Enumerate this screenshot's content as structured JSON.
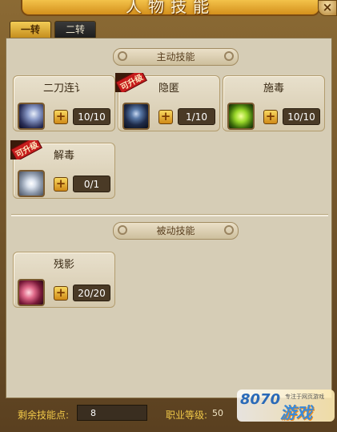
{
  "window": {
    "title": "人物技能",
    "close_label": "×"
  },
  "tabs": [
    {
      "label": "一转",
      "active": true
    },
    {
      "label": "二转",
      "active": false
    }
  ],
  "sections": {
    "active": {
      "title": "主动技能"
    },
    "passive": {
      "title": "被动技能"
    }
  },
  "skills": {
    "s1": {
      "name": "二刀连讠",
      "level": "10/10",
      "upgradable": false,
      "icon": "sword-slash-icon"
    },
    "s2": {
      "name": "隐匿",
      "level": "1/10",
      "upgradable": true,
      "badge": "可升级",
      "icon": "stealth-icon"
    },
    "s3": {
      "name": "施毒",
      "level": "10/10",
      "upgradable": false,
      "icon": "poison-icon"
    },
    "s4": {
      "name": "解毒",
      "level": "0/1",
      "upgradable": true,
      "badge": "可升级",
      "icon": "detox-icon"
    },
    "p1": {
      "name": "残影",
      "level": "20/20",
      "upgradable": false,
      "icon": "afterimage-icon"
    }
  },
  "plus_label": "+",
  "footer": {
    "points_label": "剩余技能点:",
    "points_value": "8",
    "level_label": "职业等级:",
    "level_value": "50"
  },
  "logo": {
    "number": "8070",
    "small_text": "专注于网页游戏",
    "word": "游戏"
  },
  "colors": {
    "accent_gold": "#f0c848",
    "panel_bg": "#d6cdb6",
    "upgrade_red": "#c61c1c"
  }
}
